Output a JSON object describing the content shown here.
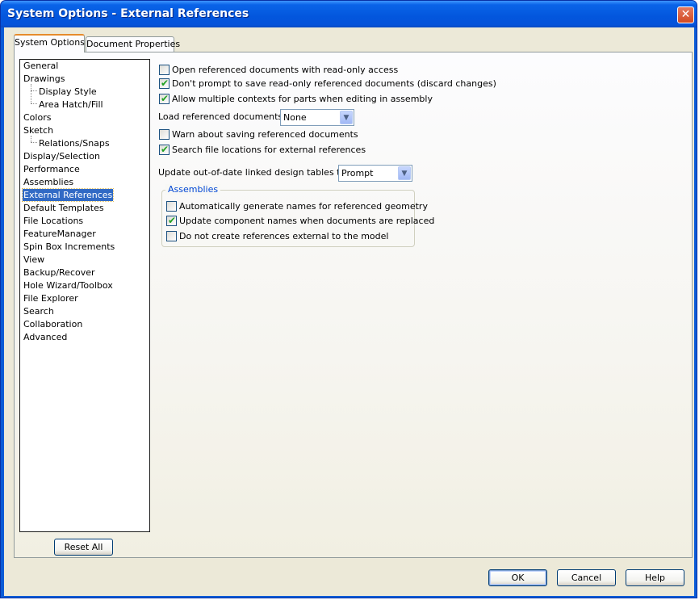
{
  "window": {
    "title": "System Options - External References",
    "close_glyph": "✕"
  },
  "tabs": [
    {
      "label": "System Options",
      "active": true
    },
    {
      "label": "Document Properties",
      "active": false
    }
  ],
  "tree": {
    "items": [
      {
        "label": "General",
        "level": 0
      },
      {
        "label": "Drawings",
        "level": 0
      },
      {
        "label": "Display Style",
        "level": 1
      },
      {
        "label": "Area Hatch/Fill",
        "level": 1
      },
      {
        "label": "Colors",
        "level": 0
      },
      {
        "label": "Sketch",
        "level": 0
      },
      {
        "label": "Relations/Snaps",
        "level": 1
      },
      {
        "label": "Display/Selection",
        "level": 0
      },
      {
        "label": "Performance",
        "level": 0
      },
      {
        "label": "Assemblies",
        "level": 0
      },
      {
        "label": "External References",
        "level": 0,
        "selected": true
      },
      {
        "label": "Default Templates",
        "level": 0
      },
      {
        "label": "File Locations",
        "level": 0
      },
      {
        "label": "FeatureManager",
        "level": 0
      },
      {
        "label": "Spin Box Increments",
        "level": 0
      },
      {
        "label": "View",
        "level": 0
      },
      {
        "label": "Backup/Recover",
        "level": 0
      },
      {
        "label": "Hole Wizard/Toolbox",
        "level": 0
      },
      {
        "label": "File Explorer",
        "level": 0
      },
      {
        "label": "Search",
        "level": 0
      },
      {
        "label": "Collaboration",
        "level": 0
      },
      {
        "label": "Advanced",
        "level": 0
      }
    ],
    "reset_label": "Reset All"
  },
  "options": {
    "open_readonly": {
      "label": "Open referenced documents with read-only access",
      "checked": false
    },
    "dont_prompt_save": {
      "label": "Don't prompt to save read-only referenced documents (discard changes)",
      "checked": true
    },
    "allow_multiple_contexts": {
      "label": "Allow multiple contexts for parts when editing in assembly",
      "checked": true
    },
    "load_referenced": {
      "label": "Load referenced documents:",
      "value": "None"
    },
    "warn_saving": {
      "label": "Warn about saving referenced documents",
      "checked": false
    },
    "search_file_locations": {
      "label": "Search file locations for external references",
      "checked": true
    },
    "update_design_tables": {
      "label": "Update out-of-date linked design tables to:",
      "value": "Prompt"
    }
  },
  "assemblies_group": {
    "title": "Assemblies",
    "auto_generate_names": {
      "label": "Automatically generate names for referenced geometry",
      "checked": false
    },
    "update_component_names": {
      "label": "Update component names when documents are replaced",
      "checked": true
    },
    "no_external_refs": {
      "label": "Do not create references external to the model",
      "checked": false
    }
  },
  "footer": {
    "ok": "OK",
    "cancel": "Cancel",
    "help": "Help"
  },
  "icons": {
    "check": "✔",
    "dropdown": "▼"
  },
  "colors": {
    "title_bar": "#0356dd",
    "selection": "#316ac5",
    "dialog_bg": "#ece9d8",
    "group_title": "#0046d5"
  }
}
